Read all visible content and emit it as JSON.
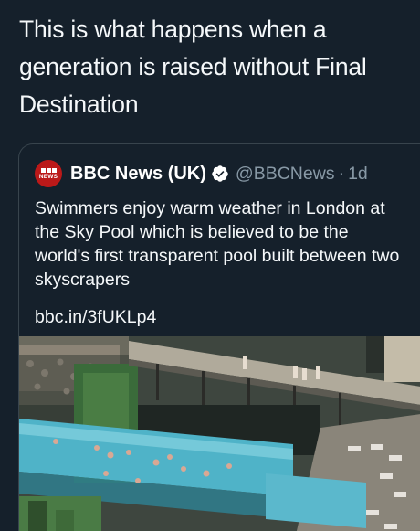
{
  "tweet": {
    "text": "This is what happens when a\ngeneration is raised without Final\nDestination"
  },
  "quoted_tweet": {
    "avatar_label": "BBC NEWS",
    "display_name": "BBC News (UK)",
    "handle": "@BBCNews",
    "separator": "·",
    "time": "1d",
    "text": "Swimmers enjoy warm weather in London at the Sky Pool which is believed to be the world's first transparent pool built between two skyscrapers",
    "link": "bbc.in/3fUKLp4"
  },
  "colors": {
    "background": "#15202b",
    "border": "#38444d",
    "secondary_text": "#8899a6",
    "verified": "#ffffff",
    "bbc_red": "#bb1919",
    "pool_water": "#4fb3c8"
  },
  "icons": {
    "verified": "verified-badge-icon",
    "avatar": "bbc-news-logo"
  }
}
